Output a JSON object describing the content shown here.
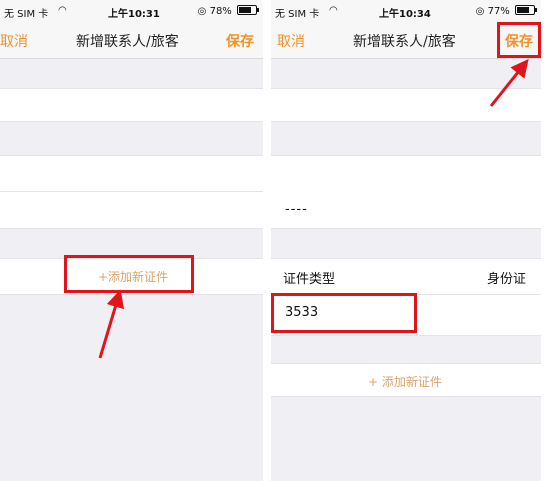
{
  "left_screen": {
    "status": {
      "carrier": "无 SIM 卡",
      "time": "上午10:31",
      "battery": "78%",
      "battery_level": 0.78
    },
    "nav": {
      "cancel": "取消",
      "title": "新增联系人/旅客",
      "save": "保存"
    },
    "add_id_link": "+添加新证件"
  },
  "right_screen": {
    "status": {
      "carrier": "无 SIM 卡",
      "time": "上午10:34",
      "battery": "77%",
      "battery_level": 0.77
    },
    "nav": {
      "cancel": "取消",
      "title": "新增联系人/旅客",
      "save": "保存"
    },
    "dash_value": "----",
    "id_type_label": "证件类型",
    "id_type_value": "身份证",
    "id_number": "3533",
    "add_id_link": "+ 添加新证件"
  },
  "colors": {
    "accent": "#f0932b",
    "highlight": "#e0151b",
    "background": "#efeff4"
  },
  "icons": [
    "wifi-icon",
    "alarm-icon",
    "battery-icon",
    "arrow-icon"
  ]
}
